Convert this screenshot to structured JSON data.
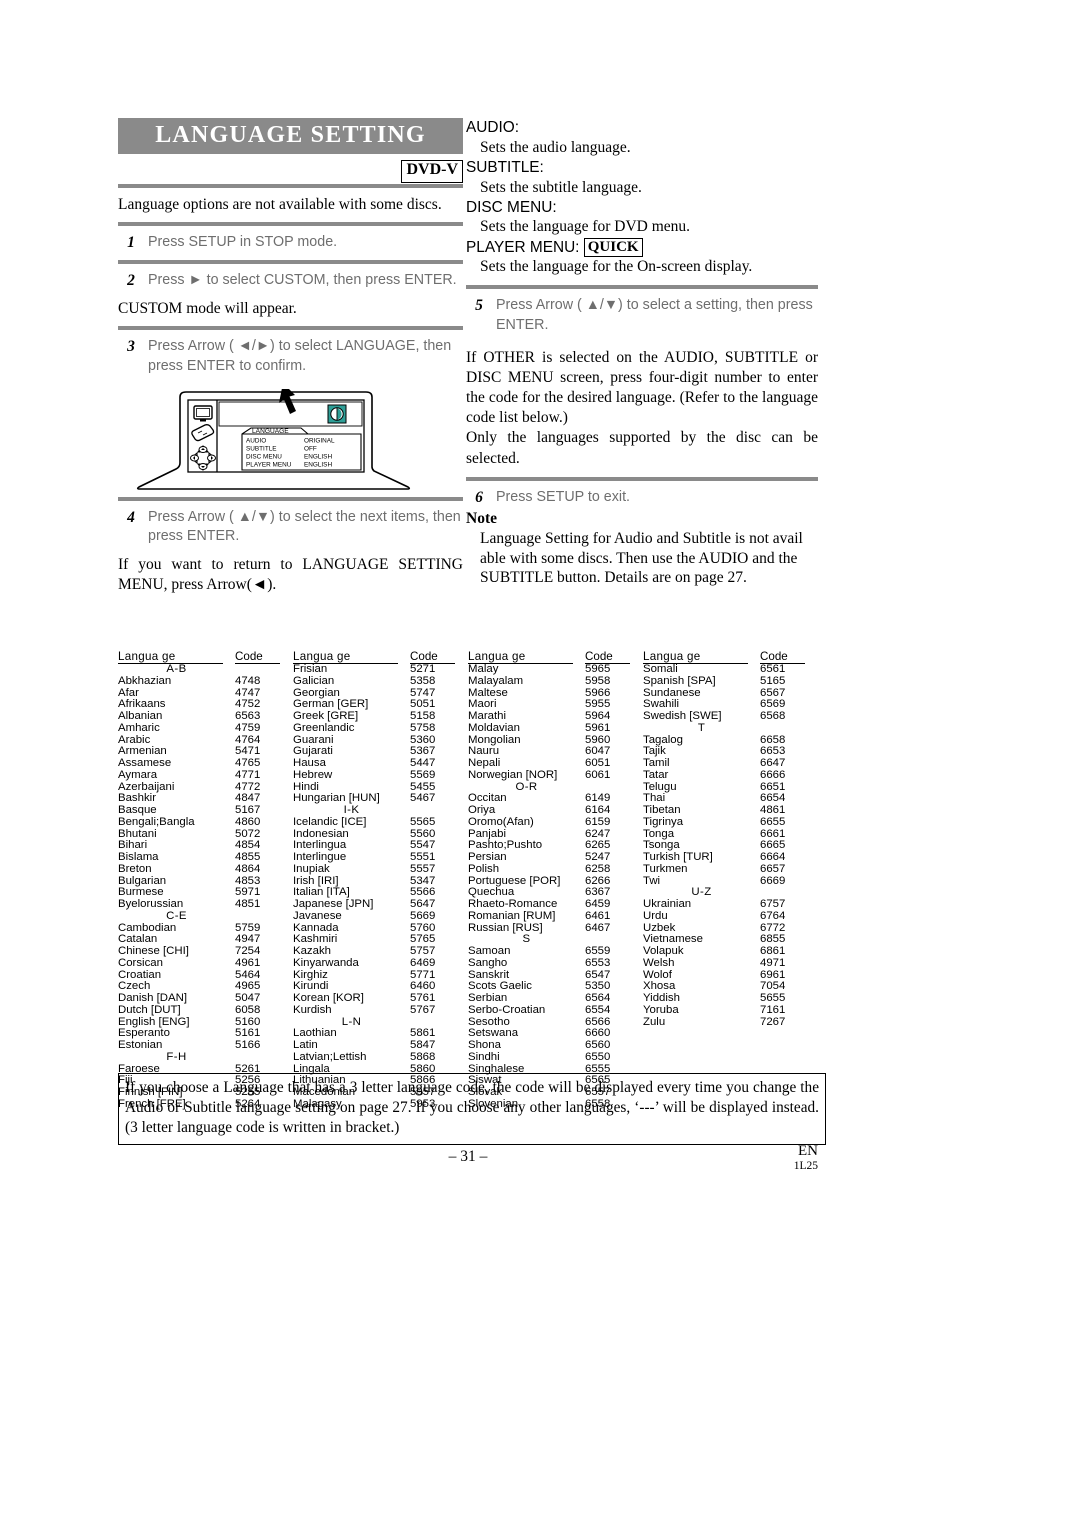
{
  "header": {
    "title": "LANGUAGE SETTING",
    "badge": "DVD-V",
    "intro": "Language options are not available with some discs."
  },
  "steps_left": [
    {
      "num": "1",
      "text": "Press SETUP in STOP mode."
    },
    {
      "num": "2",
      "text": "Press ► to select CUSTOM, then press ENTER.",
      "note": "CUSTOM mode will appear."
    },
    {
      "num": "3",
      "text": "Press Arrow ( ◄/►) to select LANGUAGE, then press ENTER to confirm."
    },
    {
      "num": "4",
      "text": "Press Arrow ( ▲/▼) to select the next items, then press ENTER.",
      "note": "If you want to return to LANGUAGE SETTING MENU, press Arrow(◄)."
    }
  ],
  "tv_screen": {
    "menu_title": "LANGUAGE",
    "rows": [
      {
        "label": "AUDIO",
        "value": "ORIGINAL"
      },
      {
        "label": "SUBTITLE",
        "value": "OFF"
      },
      {
        "label": "DISC MENU",
        "value": "ENGLISH"
      },
      {
        "label": "PLAYER MENU",
        "value": "ENGLISH"
      }
    ]
  },
  "right": {
    "definitions": [
      {
        "term": "AUDIO:",
        "desc": "Sets the audio language."
      },
      {
        "term": "SUBTITLE:",
        "desc": "Sets the subtitle language."
      },
      {
        "term": "DISC MENU:",
        "desc": "Sets the language for DVD menu."
      },
      {
        "term": "PLAYER MENU:",
        "badge": "QUICK",
        "desc": "Sets the language for the On-screen display."
      }
    ],
    "step5": {
      "num": "5",
      "text": "Press Arrow ( ▲/▼) to select a setting, then press ENTER."
    },
    "para1": "If OTHER is selected on the AUDIO, SUBTITLE or DISC MENU screen, press four-digit number to enter the code for the desired language. (Refer to the language code list below.)",
    "para2": "Only the languages supported by the disc can be selected.",
    "step6": {
      "num": "6",
      "text": "Press SETUP to exit."
    },
    "note_head": "Note",
    "note_body": "Language Setting for Audio and Subtitle is not avail able with some discs. Then use the AUDIO and the SUBTITLE button. Details are on page 27."
  },
  "lang_table": {
    "head_language": "Langua ge",
    "head_code": "Code",
    "columns": [
      {
        "rows": [
          {
            "sep": "A-B"
          },
          {
            "name": "Abkhazian",
            "code": "4748"
          },
          {
            "name": "Afar",
            "code": "4747"
          },
          {
            "name": "Afrikaans",
            "code": "4752"
          },
          {
            "name": "Albanian",
            "code": "6563"
          },
          {
            "name": "Amharic",
            "code": "4759"
          },
          {
            "name": "Arabic",
            "code": "4764"
          },
          {
            "name": "Armenian",
            "code": "5471"
          },
          {
            "name": "Assamese",
            "code": "4765"
          },
          {
            "name": "Aymara",
            "code": "4771"
          },
          {
            "name": "Azerbaijani",
            "code": "4772"
          },
          {
            "name": "Bashkir",
            "code": "4847"
          },
          {
            "name": "Basque",
            "code": "5167"
          },
          {
            "name": "Bengali;Bangla",
            "code": "4860"
          },
          {
            "name": "Bhutani",
            "code": "5072"
          },
          {
            "name": "Bihari",
            "code": "4854"
          },
          {
            "name": "Bislama",
            "code": "4855"
          },
          {
            "name": "Breton",
            "code": "4864"
          },
          {
            "name": "Bulgarian",
            "code": "4853"
          },
          {
            "name": "Burmese",
            "code": "5971"
          },
          {
            "name": "Byelorussian",
            "code": "4851"
          },
          {
            "sep": "C-E"
          },
          {
            "name": "Cambodian",
            "code": "5759"
          },
          {
            "name": "Catalan",
            "code": "4947"
          },
          {
            "name": "Chinese [CHI]",
            "code": "7254"
          },
          {
            "name": "Corsican",
            "code": "4961"
          },
          {
            "name": "Croatian",
            "code": "5464"
          },
          {
            "name": "Czech",
            "code": "4965"
          },
          {
            "name": "Danish [DAN]",
            "code": "5047"
          },
          {
            "name": "Dutch [DUT]",
            "code": "6058"
          },
          {
            "name": "English [ENG]",
            "code": "5160"
          },
          {
            "name": "Esperanto",
            "code": "5161"
          },
          {
            "name": "Estonian",
            "code": "5166"
          },
          {
            "sep": "F-H"
          },
          {
            "name": "Faroese",
            "code": "5261"
          },
          {
            "name": "Fiji",
            "code": "5256"
          },
          {
            "name": "Finnish [FIN]",
            "code": "5255"
          },
          {
            "name": "French [FRE]",
            "code": "5264"
          }
        ]
      },
      {
        "rows": [
          {
            "name": "Frisian",
            "code": "5271"
          },
          {
            "name": "Galician",
            "code": "5358"
          },
          {
            "name": "Georgian",
            "code": "5747"
          },
          {
            "name": "German [GER]",
            "code": "5051"
          },
          {
            "name": "Greek [GRE]",
            "code": "5158"
          },
          {
            "name": "Greenlandic",
            "code": "5758"
          },
          {
            "name": "Guarani",
            "code": "5360"
          },
          {
            "name": "Gujarati",
            "code": "5367"
          },
          {
            "name": "Hausa",
            "code": "5447"
          },
          {
            "name": "Hebrew",
            "code": "5569"
          },
          {
            "name": "Hindi",
            "code": "5455"
          },
          {
            "name": "Hungarian [HUN]",
            "code": "5467"
          },
          {
            "sep": "I-K"
          },
          {
            "name": "Icelandic [ICE]",
            "code": "5565"
          },
          {
            "name": "Indonesian",
            "code": "5560"
          },
          {
            "name": "Interlingua",
            "code": "5547"
          },
          {
            "name": "Interlingue",
            "code": "5551"
          },
          {
            "name": "Inupiak",
            "code": "5557"
          },
          {
            "name": "Irish [IRI]",
            "code": "5347"
          },
          {
            "name": "Italian [ITA]",
            "code": "5566"
          },
          {
            "name": "Japanese [JPN]",
            "code": "5647"
          },
          {
            "name": "Javanese",
            "code": "5669"
          },
          {
            "name": "Kannada",
            "code": "5760"
          },
          {
            "name": "Kashmiri",
            "code": "5765"
          },
          {
            "name": "Kazakh",
            "code": "5757"
          },
          {
            "name": "Kinyarwanda",
            "code": "6469"
          },
          {
            "name": "Kirghiz",
            "code": "5771"
          },
          {
            "name": "Kirundi",
            "code": "6460"
          },
          {
            "name": "Korean [KOR]",
            "code": "5761"
          },
          {
            "name": "Kurdish",
            "code": "5767"
          },
          {
            "sep": "L-N"
          },
          {
            "name": "Laothian",
            "code": "5861"
          },
          {
            "name": "Latin",
            "code": "5847"
          },
          {
            "name": "Latvian;Lettish",
            "code": "5868"
          },
          {
            "name": "Lingala",
            "code": "5860"
          },
          {
            "name": "Lithuanian",
            "code": "5866"
          },
          {
            "name": "Macedonian",
            "code": "5957"
          },
          {
            "name": "Malagasy",
            "code": "5953"
          }
        ]
      },
      {
        "rows": [
          {
            "name": "Malay",
            "code": "5965"
          },
          {
            "name": "Malayalam",
            "code": "5958"
          },
          {
            "name": "Maltese",
            "code": "5966"
          },
          {
            "name": "Maori",
            "code": "5955"
          },
          {
            "name": "Marathi",
            "code": "5964"
          },
          {
            "name": "Moldavian",
            "code": "5961"
          },
          {
            "name": "Mongolian",
            "code": "5960"
          },
          {
            "name": "Nauru",
            "code": "6047"
          },
          {
            "name": "Nepali",
            "code": "6051"
          },
          {
            "name": "Norwegian [NOR]",
            "code": "6061"
          },
          {
            "sep": "O-R"
          },
          {
            "name": "Occitan",
            "code": "6149"
          },
          {
            "name": "Oriya",
            "code": "6164"
          },
          {
            "name": "Oromo(Afan)",
            "code": "6159"
          },
          {
            "name": "Panjabi",
            "code": "6247"
          },
          {
            "name": "Pashto;Pushto",
            "code": "6265"
          },
          {
            "name": "Persian",
            "code": "5247"
          },
          {
            "name": "Polish",
            "code": "6258"
          },
          {
            "name": "Portuguese [POR]",
            "code": "6266"
          },
          {
            "name": "Quechua",
            "code": "6367"
          },
          {
            "name": "Rhaeto-Romance",
            "code": "6459"
          },
          {
            "name": "Romanian [RUM]",
            "code": "6461"
          },
          {
            "name": "Russian [RUS]",
            "code": "6467"
          },
          {
            "sep": "S"
          },
          {
            "name": "Samoan",
            "code": "6559"
          },
          {
            "name": "Sangho",
            "code": "6553"
          },
          {
            "name": "Sanskrit",
            "code": "6547"
          },
          {
            "name": "Scots Gaelic",
            "code": "5350"
          },
          {
            "name": "Serbian",
            "code": "6564"
          },
          {
            "name": "Serbo-Croatian",
            "code": "6554"
          },
          {
            "name": "Sesotho",
            "code": "6566"
          },
          {
            "name": "Setswana",
            "code": "6660"
          },
          {
            "name": "Shona",
            "code": "6560"
          },
          {
            "name": "Sindhi",
            "code": "6550"
          },
          {
            "name": "Singhalese",
            "code": "6555"
          },
          {
            "name": "Siswat",
            "code": "6565"
          },
          {
            "name": "Slovak",
            "code": "6557"
          },
          {
            "name": "Slovenian",
            "code": "6558"
          }
        ]
      },
      {
        "rows": [
          {
            "name": "Somali",
            "code": "6561"
          },
          {
            "name": "Spanish [SPA]",
            "code": "5165"
          },
          {
            "name": "Sundanese",
            "code": "6567"
          },
          {
            "name": "Swahili",
            "code": "6569"
          },
          {
            "name": "Swedish [SWE]",
            "code": "6568"
          },
          {
            "sep": "T"
          },
          {
            "name": "Tagalog",
            "code": "6658"
          },
          {
            "name": "Tajik",
            "code": "6653"
          },
          {
            "name": "Tamil",
            "code": "6647"
          },
          {
            "name": "Tatar",
            "code": "6666"
          },
          {
            "name": "Telugu",
            "code": "6651"
          },
          {
            "name": "Thai",
            "code": "6654"
          },
          {
            "name": "Tibetan",
            "code": "4861"
          },
          {
            "name": "Tigrinya",
            "code": "6655"
          },
          {
            "name": "Tonga",
            "code": "6661"
          },
          {
            "name": "Tsonga",
            "code": "6665"
          },
          {
            "name": "Turkish [TUR]",
            "code": "6664"
          },
          {
            "name": "Turkmen",
            "code": "6657"
          },
          {
            "name": "Twi",
            "code": "6669"
          },
          {
            "sep": "U-Z"
          },
          {
            "name": "Ukrainian",
            "code": "6757"
          },
          {
            "name": "Urdu",
            "code": "6764"
          },
          {
            "name": "Uzbek",
            "code": "6772"
          },
          {
            "name": "Vietnamese",
            "code": "6855"
          },
          {
            "name": "Volapuk",
            "code": "6861"
          },
          {
            "name": "Welsh",
            "code": "4971"
          },
          {
            "name": "Wolof",
            "code": "6961"
          },
          {
            "name": "Xhosa",
            "code": "7054"
          },
          {
            "name": "Yiddish",
            "code": "5655"
          },
          {
            "name": "Yoruba",
            "code": "7161"
          },
          {
            "name": "Zulu",
            "code": "7267"
          }
        ]
      }
    ]
  },
  "bottom_note": "If you choose a Language that has a 3 letter language code, the code will be displayed every time you change the Audio or Subtitle language setting on page 27. If you choose any other languages, ‘---’ will be displayed instead. (3 letter language code is written in bracket.)",
  "footer": {
    "page": "– 31 –",
    "region": "EN",
    "doc_code": "1L25"
  },
  "colors": {
    "banner": "#8a8a8a",
    "step_text": "#6e6e6e",
    "screen_icon": "#2e9e96"
  }
}
